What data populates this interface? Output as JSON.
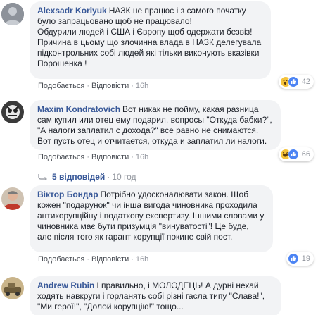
{
  "colors": {
    "link": "#385898",
    "bubble": "#f2f3f5",
    "meta": "#90949c"
  },
  "comments": [
    {
      "author": "Alexsadr Korlyuk",
      "text": "НАЗК не працює і з самого початку було запрацьовано щоб не працювало!\nОбдурили людей і США і Європу щоб одержати безвіз!\nПричина в цьому що злочинна влада в НАЗК делегувала підконтрольних собі людей які тільки виконують вказівки Порошенка !",
      "like": "Подобається",
      "reply": "Відповісти",
      "time": "16h",
      "reaction_icons": [
        "wow-icon",
        "like-icon"
      ],
      "reaction_count": "42"
    },
    {
      "author": "Maxim Kondratovich",
      "text": "Вот никак не пойму, какая разница сам купил или отец ему подарил, вопросы \"Откуда бабки?\", \"А налоги заплатил с дохода?\" все равно не снимаются.\nВот пусть отец и отчитается, откуда и заплатил ли налоги.",
      "like": "Подобається",
      "reply": "Відповісти",
      "time": "16h",
      "reaction_icons": [
        "haha-icon",
        "like-icon"
      ],
      "reaction_count": "66",
      "replies_label": "5 відповідей",
      "replies_sep": "·",
      "replies_time": "10 год"
    },
    {
      "author": "Віктор Бондар",
      "text": "Потрібно удосконалювати закон. Щоб кожен \"подарунок\" чи інша вигода чиновника проходила антикорупційну і податкову експертизу. Іншими словами у чиновника має бути призумція \"винуватості\"! Це буде, але після того як гарант корупції покине свій пост.",
      "like": "Подобається",
      "reply": "Відповісти",
      "time": "16h",
      "reaction_icons": [
        "like-icon"
      ],
      "reaction_count": "19"
    },
    {
      "author": "Andrew Rubin",
      "text": "І правильно, і МОЛОДЕЦЬ! А дурні нехай ходять навкруги і горланять собі різні гасла типу \"Слава!\", \"Ми герої!\", \"Долой корупцію!\" тощо..."
    }
  ]
}
